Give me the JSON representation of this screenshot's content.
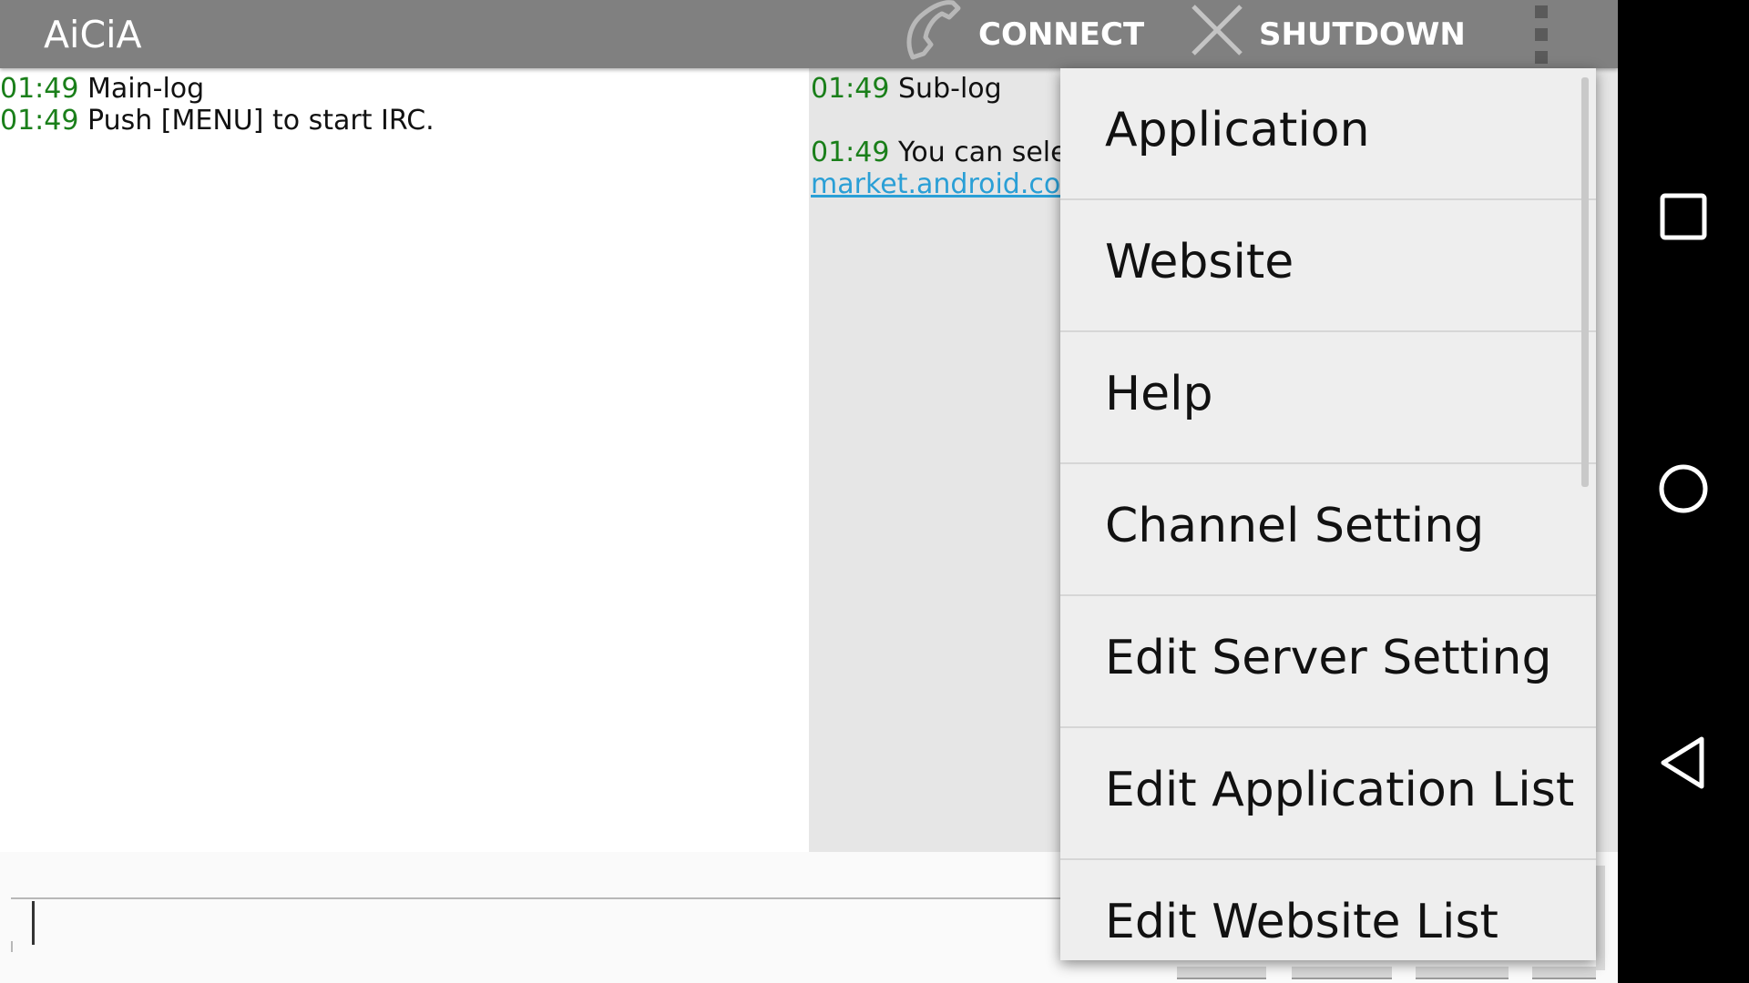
{
  "app": {
    "title": "AiCiA"
  },
  "actionbar": {
    "connect": {
      "label": "CONNECT",
      "icon": "phone-icon"
    },
    "shutdown": {
      "label": "SHUTDOWN",
      "icon": "close-icon"
    },
    "overflow_icon": "overflow-menu-icon"
  },
  "main_log": {
    "lines": [
      {
        "time": "01:49",
        "text": "Main-log"
      },
      {
        "time": "01:49",
        "text": "Push [MENU] to start IRC."
      }
    ]
  },
  "sub_log": {
    "lines": [
      {
        "time": "01:49",
        "text": "Sub-log"
      },
      {
        "time": "01:49",
        "text": "You can select"
      }
    ],
    "link": "market.android.com/"
  },
  "menu": {
    "items": [
      "Application",
      "Website",
      "Help",
      "Channel Setting",
      "Edit Server Setting",
      "Edit Application List",
      "Edit Website List"
    ]
  },
  "navbar": {
    "recents_icon": "recents-icon",
    "home_icon": "home-icon",
    "back_icon": "back-icon"
  },
  "colors": {
    "actionbar": "#808080",
    "timestamp": "#1a7f1a",
    "link": "#2a9fd6",
    "sublog_bg": "#e6e6e6",
    "menu_bg": "#eeeeee"
  }
}
